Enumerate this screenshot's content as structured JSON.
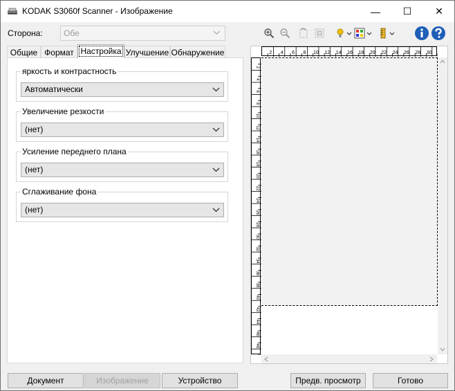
{
  "window": {
    "title": "KODAK S3060f Scanner - Изображение",
    "minimize": "—",
    "maximize": "☐",
    "close": "✕"
  },
  "side": {
    "label": "Сторона:",
    "value": "Обе"
  },
  "toolbar": {
    "icons": [
      "zoom-in-icon",
      "zoom-out-icon",
      "rotate-icon",
      "crop-icon",
      "brightness-icon",
      "color-icon",
      "ruler-icon",
      "info-icon",
      "help-icon"
    ]
  },
  "tabs": [
    {
      "label": "Общие"
    },
    {
      "label": "Формат"
    },
    {
      "label": "Настройка"
    },
    {
      "label": "Улучшение"
    },
    {
      "label": "Обнаружение"
    }
  ],
  "groups": [
    {
      "title": "яркость и контрастность",
      "value": "Автоматически"
    },
    {
      "title": "Увеличение резкости",
      "value": "(нет)"
    },
    {
      "title": "Усиление переднего плана",
      "value": "(нет)"
    },
    {
      "title": "Сглаживание фона",
      "value": "(нет)"
    }
  ],
  "ruler": {
    "h_ticks": [
      "2",
      "4",
      "6",
      "8",
      "10",
      "12",
      "14",
      "16",
      "18",
      "20",
      "22",
      "24",
      "26",
      "28",
      "30"
    ],
    "v_ticks": [
      "2",
      "4",
      "6",
      "8",
      "10",
      "12",
      "14",
      "16",
      "18",
      "20",
      "22",
      "24",
      "26",
      "28",
      "30",
      "32",
      "34",
      "36",
      "38",
      "40",
      "42",
      "44",
      "46",
      "48"
    ]
  },
  "buttons": {
    "document": "Документ",
    "image": "Изображение",
    "device": "Устройство",
    "preview": "Предв. просмотр",
    "ok": "Готово"
  }
}
